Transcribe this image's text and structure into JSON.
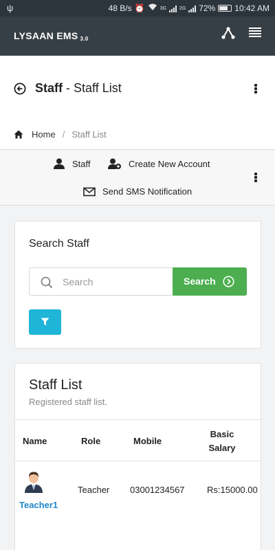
{
  "status_bar": {
    "speed": "48 B/s",
    "net1": "3G",
    "net2": "2G",
    "battery": "72%",
    "battery_level": 0.72,
    "time": "10:42 AM"
  },
  "app": {
    "brand": "LYSAAN EMS",
    "version": "3.0"
  },
  "header": {
    "title_bold": "Staff",
    "title_sep": " - ",
    "title_rest": "Staff List"
  },
  "breadcrumb": {
    "home": "Home",
    "separator": "/",
    "current": "Staff List"
  },
  "actions": {
    "staff": "Staff",
    "create": "Create New Account",
    "sms": "Send SMS Notification"
  },
  "search": {
    "title": "Search Staff",
    "placeholder": "Search",
    "button": "Search"
  },
  "staff_list": {
    "title": "Staff List",
    "subtitle": "Registered staff list.",
    "columns": {
      "name": "Name",
      "role": "Role",
      "mobile": "Mobile",
      "salary_line1": "Basic",
      "salary_line2": "Salary"
    },
    "rows": [
      {
        "name": "Teacher1",
        "role": "Teacher",
        "mobile": "03001234567",
        "salary": "Rs:15000.00"
      }
    ]
  },
  "colors": {
    "status_bar": "#2d353c",
    "app_bar": "#373f46",
    "search_button": "#4cae4f",
    "filter_button": "#1fb5d8",
    "link": "#1f86c9"
  }
}
